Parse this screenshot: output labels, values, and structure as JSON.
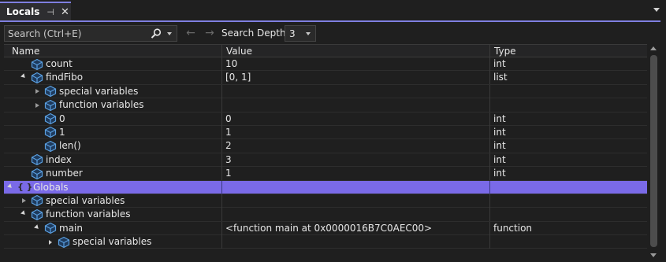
{
  "window": {
    "tab_title": "Locals",
    "pin_glyph": "⊣",
    "close_glyph": "✕"
  },
  "toolbar": {
    "search_placeholder": "Search (Ctrl+E)",
    "back_glyph": "←",
    "forward_glyph": "→",
    "depth_label": "Search Depth:",
    "depth_value": "3"
  },
  "columns": {
    "name": "Name",
    "value": "Value",
    "type": "Type"
  },
  "rows": [
    {
      "name": "count",
      "value": "10",
      "type": "int",
      "level": 1,
      "expander": "none",
      "icon": "field-icon"
    },
    {
      "name": "findFibo",
      "value": "[0, 1]",
      "type": "list",
      "level": 1,
      "expander": "open",
      "icon": "field-icon"
    },
    {
      "name": "special variables",
      "value": "",
      "type": "",
      "level": 2,
      "expander": "closed",
      "icon": "field-icon"
    },
    {
      "name": "function variables",
      "value": "",
      "type": "",
      "level": 2,
      "expander": "closed",
      "icon": "field-icon"
    },
    {
      "name": "0",
      "value": "0",
      "type": "int",
      "level": 2,
      "expander": "none",
      "icon": "field-icon"
    },
    {
      "name": "1",
      "value": "1",
      "type": "int",
      "level": 2,
      "expander": "none",
      "icon": "field-icon"
    },
    {
      "name": "len()",
      "value": "2",
      "type": "int",
      "level": 2,
      "expander": "none",
      "icon": "field-icon"
    },
    {
      "name": "index",
      "value": "3",
      "type": "int",
      "level": 1,
      "expander": "none",
      "icon": "field-icon"
    },
    {
      "name": "number",
      "value": "1",
      "type": "int",
      "level": 1,
      "expander": "none",
      "icon": "field-icon"
    },
    {
      "name": "Globals",
      "value": "",
      "type": "",
      "level": 0,
      "expander": "open",
      "icon": "braces-icon",
      "selected": true
    },
    {
      "name": "special variables",
      "value": "",
      "type": "",
      "level": 1,
      "expander": "closed",
      "icon": "field-icon"
    },
    {
      "name": "function variables",
      "value": "",
      "type": "",
      "level": 1,
      "expander": "open",
      "icon": "field-icon"
    },
    {
      "name": "main",
      "value": "<function main at 0x0000016B7C0AEC00>",
      "type": "function",
      "level": 2,
      "expander": "open",
      "icon": "field-icon"
    },
    {
      "name": "special variables",
      "value": "",
      "type": "",
      "level": 3,
      "expander": "closed-hollow",
      "icon": "field-icon"
    }
  ],
  "colors": {
    "accent": "#7f7fe0",
    "selection": "#7a6ae8",
    "icon_blue": "#5a9fe0"
  }
}
